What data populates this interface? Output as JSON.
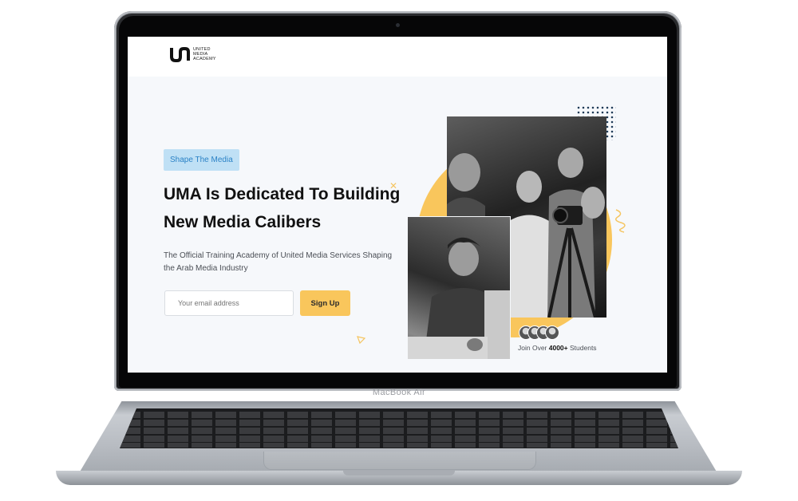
{
  "device": {
    "label": "MacBook Air"
  },
  "site": {
    "brand": {
      "line1": "UNITED",
      "line2": "MEDIA",
      "line3": "ACADEMY"
    },
    "hero": {
      "tag": "Shape The Media",
      "headline_line1": "UMA Is Dedicated To Building",
      "headline_line2": "New Media Calibers",
      "subtext": "The Official Training Academy of United Media Services Shaping the Arab Media Industry",
      "email_placeholder": "Your email address",
      "signup_label": "Sign Up"
    },
    "students": {
      "prefix": "Join Over",
      "count": "4000+",
      "suffix": "Students"
    }
  },
  "colors": {
    "accent": "#f9c65c",
    "tag_bg": "#bfe0f5",
    "tag_text": "#2b82c6",
    "dots": "#1f3b57"
  }
}
